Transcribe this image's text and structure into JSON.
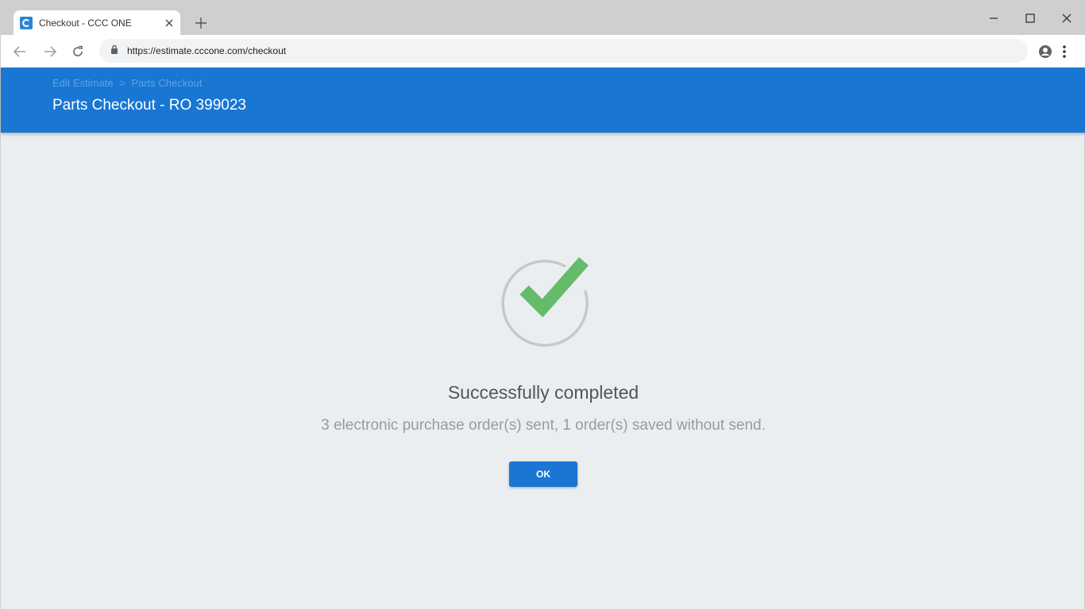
{
  "browser": {
    "tab_title": "Checkout - CCC ONE",
    "url": "https://estimate.cccone.com/checkout"
  },
  "header": {
    "breadcrumb": {
      "parent": "Edit Estimate",
      "separator": ">",
      "current": "Parts Checkout"
    },
    "title": "Parts Checkout - RO 399023"
  },
  "result": {
    "heading": "Successfully completed",
    "message": "3 electronic purchase order(s) sent, 1 order(s) saved without send.",
    "ok_label": "OK"
  },
  "colors": {
    "accent": "#1976d2",
    "success": "#66bb6a",
    "ring": "#c8c8c8"
  },
  "icons": [
    "back-arrow-icon",
    "forward-arrow-icon",
    "reload-icon",
    "lock-icon",
    "account-icon",
    "kebab-menu-icon",
    "checkmark-icon"
  ]
}
